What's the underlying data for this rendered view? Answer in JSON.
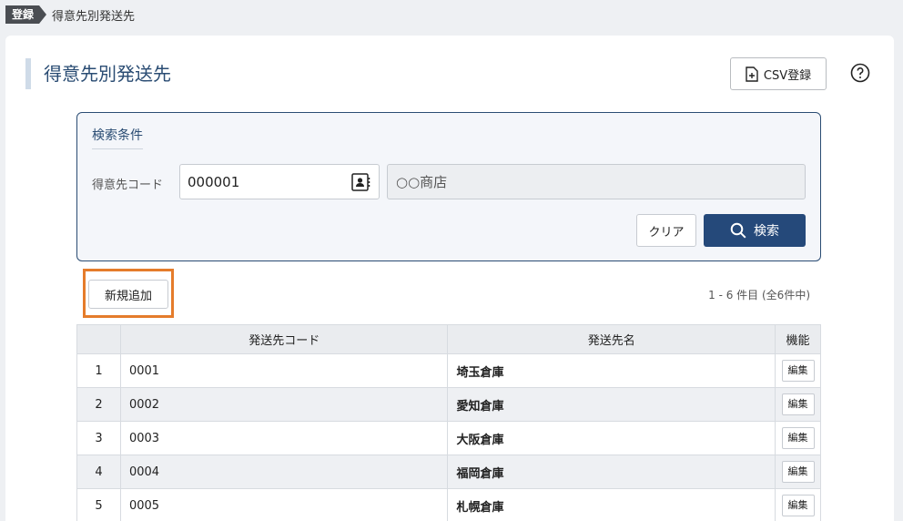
{
  "breadcrumb": {
    "tag": "登録",
    "current": "得意先別発送先"
  },
  "header": {
    "title": "得意先別発送先",
    "csv_label": "CSV登録"
  },
  "search": {
    "title": "検索条件",
    "code_label": "得意先コード",
    "code_value": "000001",
    "name_value": "○○商店",
    "clear_label": "クリア",
    "search_label": "検索"
  },
  "list": {
    "add_label": "新規追加",
    "count_text": "1 - 6 件目 (全6件中)",
    "columns": [
      "",
      "発送先コード",
      "発送先名",
      "機能"
    ],
    "rows": [
      {
        "no": "1",
        "code": "0001",
        "name": "埼玉倉庫",
        "action": "編集"
      },
      {
        "no": "2",
        "code": "0002",
        "name": "愛知倉庫",
        "action": "編集"
      },
      {
        "no": "3",
        "code": "0003",
        "name": "大阪倉庫",
        "action": "編集"
      },
      {
        "no": "4",
        "code": "0004",
        "name": "福岡倉庫",
        "action": "編集"
      },
      {
        "no": "5",
        "code": "0005",
        "name": "札幌倉庫",
        "action": "編集"
      }
    ]
  },
  "colors": {
    "accent": "#25497a",
    "title": "#2a4c73",
    "highlight": "#e57c2b"
  },
  "icons": {
    "csv": "file-plus-icon",
    "help": "help-circle-icon",
    "contact": "contact-card-icon",
    "search": "search-icon"
  }
}
